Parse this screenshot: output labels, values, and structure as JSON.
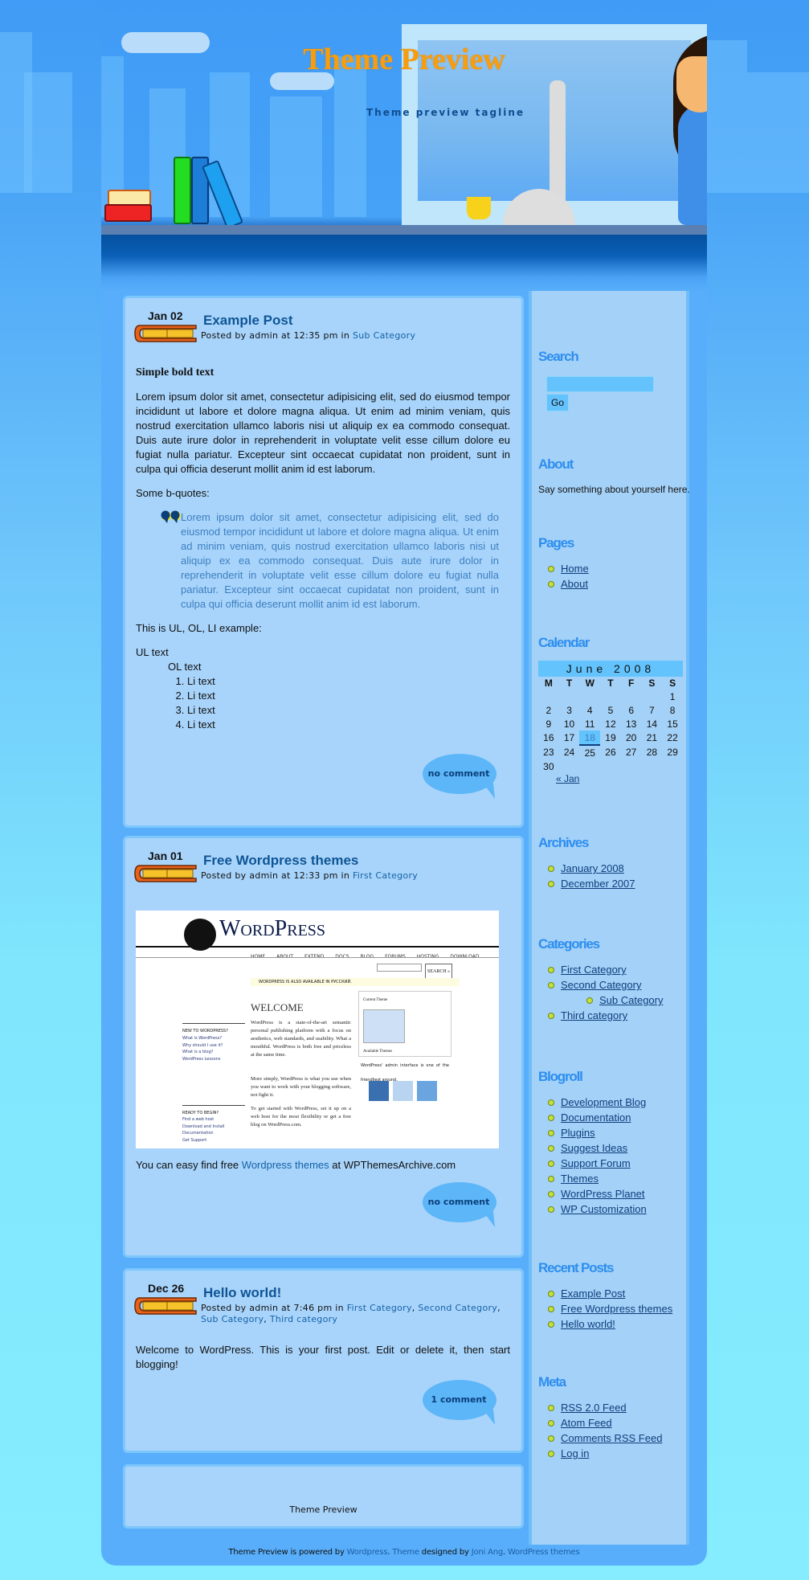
{
  "header": {
    "title": "Theme Preview",
    "tagline": "Theme preview tagline"
  },
  "posts": [
    {
      "date": "Jan 02",
      "title": "Example Post",
      "meta_prefix": "Posted by admin at 12:35 pm in ",
      "categories": [
        "Sub Category"
      ],
      "bold_text": "Simple bold text",
      "paragraph": "Lorem ipsum dolor sit amet, consectetur adipisicing elit, sed do eiusmod tempor incididunt ut labore et dolore magna aliqua. Ut enim ad minim veniam, quis nostrud exercitation ullamco laboris nisi ut aliquip ex ea commodo consequat. Duis aute irure dolor in reprehenderit in voluptate velit esse cillum dolore eu fugiat nulla pariatur. Excepteur sint occaecat cupidatat non proident, sunt in culpa qui officia deserunt mollit anim id est laborum.",
      "bquote_intro": "Some b-quotes:",
      "blockquote": "Lorem ipsum dolor sit amet, consectetur adipisicing elit, sed do eiusmod tempor incididunt ut labore et dolore magna aliqua. Ut enim ad minim veniam, quis nostrud exercitation ullamco laboris nisi ut aliquip ex ea commodo consequat. Duis aute irure dolor in reprehenderit in voluptate velit esse cillum dolore eu fugiat nulla pariatur. Excepteur sint occaecat cupidatat non proident, sunt in culpa qui officia deserunt mollit anim id est laborum.",
      "list_intro": "This is UL, OL, LI example:",
      "ul_text": "UL text",
      "ol_text": "OL text",
      "li_items": [
        "Li text",
        "Li text",
        "Li text",
        "Li text"
      ],
      "comments": "no comment"
    },
    {
      "date": "Jan 01",
      "title": "Free Wordpress themes",
      "meta_prefix": "Posted by admin at 12:33 pm in ",
      "categories": [
        "First Category"
      ],
      "image": {
        "logo": "WordPress",
        "nav": [
          "HOME",
          "ABOUT",
          "EXTEND",
          "DOCS",
          "BLOG",
          "FORUMS",
          "HOSTING",
          "DOWNLOAD"
        ],
        "search_button": "SEARCH »",
        "notice": "WORDPRESS IS ALSO AVAILABLE IN РУССКИЙ.",
        "welcome": "WELCOME",
        "new_heading": "NEW TO WORDPRESS?",
        "new_links": [
          "What is WordPress?",
          "Why should I use it?",
          "What is a blog?",
          "WordPress Lessons"
        ],
        "ready_heading": "READY TO BEGIN?",
        "ready_links": [
          "Find a web host",
          "Download and Install",
          "Documentation",
          "Get Support"
        ],
        "body1": "WordPress is a state-of-the-art semantic personal publishing platform with a focus on aesthetics, web standards, and usability. What a mouthful. WordPress is both free and priceless at the same time.",
        "body2": "More simply, WordPress is what you use when you want to work with your blogging software, not fight it.",
        "body3": "To get started with WordPress, set it up on a web host for the most flexibility or get a free blog on WordPress.com.",
        "caption": "WordPress' admin interface is one of the friendliest around.",
        "current_theme": "Current Theme",
        "available_themes": "Available Themes"
      },
      "text_prefix": "You can easy find free ",
      "text_link": "Wordpress themes",
      "text_suffix": " at WPThemesArchive.com",
      "comments": "no comment"
    },
    {
      "date": "Dec 26",
      "title": "Hello world!",
      "meta_prefix": "Posted by admin at 7:46 pm in ",
      "categories": [
        "First Category",
        "Second Category",
        "Sub Category",
        "Third category"
      ],
      "paragraph": "Welcome to WordPress. This is your first post. Edit or delete it, then start blogging!",
      "comments": "1 comment"
    }
  ],
  "footer_box": "Theme Preview",
  "credits": {
    "t1": "Theme Preview is powered by ",
    "l1": "Wordpress",
    "t2": ". ",
    "l2": "Theme",
    "t3": " designed by ",
    "l3": "Joni Ang",
    "t4": ". ",
    "l4": "WordPress themes"
  },
  "sidebar": {
    "search": {
      "title": "Search",
      "placeholder": "",
      "value": "",
      "button": "Go"
    },
    "about": {
      "title": "About",
      "text": "Say something about yourself here."
    },
    "pages": {
      "title": "Pages",
      "items": [
        "Home",
        "About"
      ]
    },
    "calendar": {
      "title": "Calendar",
      "caption": "June 2008",
      "weekdays": [
        "M",
        "T",
        "W",
        "T",
        "F",
        "S",
        "S"
      ],
      "weeks": [
        [
          "",
          "",
          "",
          "",
          "",
          "",
          "1"
        ],
        [
          "2",
          "3",
          "4",
          "5",
          "6",
          "7",
          "8"
        ],
        [
          "9",
          "10",
          "11",
          "12",
          "13",
          "14",
          "15"
        ],
        [
          "16",
          "17",
          "18",
          "19",
          "20",
          "21",
          "22"
        ],
        [
          "23",
          "24",
          "25",
          "26",
          "27",
          "28",
          "29"
        ],
        [
          "30",
          "",
          "",
          "",
          "",
          "",
          ""
        ]
      ],
      "today": "18",
      "prev": "« Jan"
    },
    "archives": {
      "title": "Archives",
      "items": [
        "January 2008",
        "December 2007"
      ]
    },
    "categories": {
      "title": "Categories",
      "items": [
        "First Category",
        "Second Category",
        "Sub Category",
        "Third category"
      ]
    },
    "blogroll": {
      "title": "Blogroll",
      "items": [
        "Development Blog",
        "Documentation",
        "Plugins",
        "Suggest Ideas",
        "Support Forum",
        "Themes",
        "WordPress Planet",
        "WP Customization"
      ]
    },
    "recent": {
      "title": "Recent Posts",
      "items": [
        "Example Post",
        "Free Wordpress themes",
        "Hello world!"
      ]
    },
    "meta": {
      "title": "Meta",
      "items": [
        "RSS 2.0 Feed",
        "Atom Feed",
        "Comments RSS Feed",
        "Log in"
      ]
    }
  }
}
